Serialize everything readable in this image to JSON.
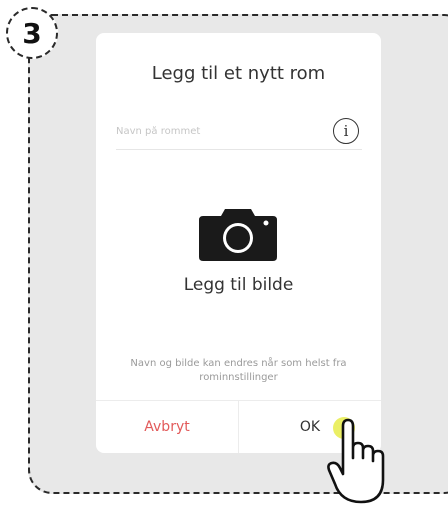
{
  "step_badge": {
    "number": "3"
  },
  "dialog": {
    "title": "Legg til et nytt rom",
    "name_input": {
      "value": "",
      "placeholder": "Navn på rommet"
    },
    "info_icon": "info-icon",
    "photo": {
      "icon": "camera-icon",
      "label": "Legg til bilde"
    },
    "hint": "Navn og bilde kan endres når som helst fra rominnstillinger",
    "buttons": {
      "cancel": "Avbryt",
      "ok": "OK"
    }
  },
  "pointer": {
    "icon": "hand-pointer-icon"
  },
  "colors": {
    "cancel": "#e25a5a",
    "text": "#333333",
    "placeholder": "#c6c6c6",
    "hint": "#9a9a9a",
    "frame_bg": "#e8e8e8",
    "tap_highlight": "#e8ec4a"
  }
}
